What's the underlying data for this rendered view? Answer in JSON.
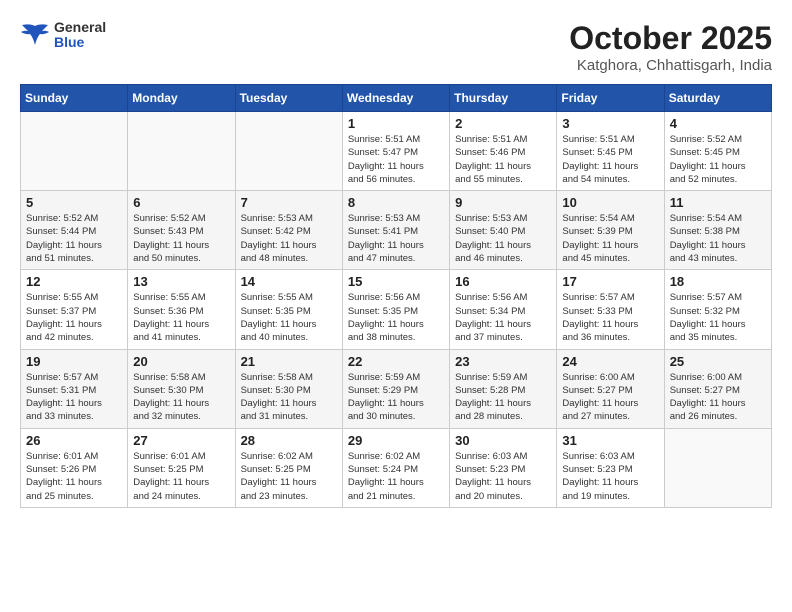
{
  "header": {
    "logo_general": "General",
    "logo_blue": "Blue",
    "month": "October 2025",
    "location": "Katghora, Chhattisgarh, India"
  },
  "weekdays": [
    "Sunday",
    "Monday",
    "Tuesday",
    "Wednesday",
    "Thursday",
    "Friday",
    "Saturday"
  ],
  "weeks": [
    [
      {
        "day": "",
        "info": ""
      },
      {
        "day": "",
        "info": ""
      },
      {
        "day": "",
        "info": ""
      },
      {
        "day": "1",
        "info": "Sunrise: 5:51 AM\nSunset: 5:47 PM\nDaylight: 11 hours\nand 56 minutes."
      },
      {
        "day": "2",
        "info": "Sunrise: 5:51 AM\nSunset: 5:46 PM\nDaylight: 11 hours\nand 55 minutes."
      },
      {
        "day": "3",
        "info": "Sunrise: 5:51 AM\nSunset: 5:45 PM\nDaylight: 11 hours\nand 54 minutes."
      },
      {
        "day": "4",
        "info": "Sunrise: 5:52 AM\nSunset: 5:45 PM\nDaylight: 11 hours\nand 52 minutes."
      }
    ],
    [
      {
        "day": "5",
        "info": "Sunrise: 5:52 AM\nSunset: 5:44 PM\nDaylight: 11 hours\nand 51 minutes."
      },
      {
        "day": "6",
        "info": "Sunrise: 5:52 AM\nSunset: 5:43 PM\nDaylight: 11 hours\nand 50 minutes."
      },
      {
        "day": "7",
        "info": "Sunrise: 5:53 AM\nSunset: 5:42 PM\nDaylight: 11 hours\nand 48 minutes."
      },
      {
        "day": "8",
        "info": "Sunrise: 5:53 AM\nSunset: 5:41 PM\nDaylight: 11 hours\nand 47 minutes."
      },
      {
        "day": "9",
        "info": "Sunrise: 5:53 AM\nSunset: 5:40 PM\nDaylight: 11 hours\nand 46 minutes."
      },
      {
        "day": "10",
        "info": "Sunrise: 5:54 AM\nSunset: 5:39 PM\nDaylight: 11 hours\nand 45 minutes."
      },
      {
        "day": "11",
        "info": "Sunrise: 5:54 AM\nSunset: 5:38 PM\nDaylight: 11 hours\nand 43 minutes."
      }
    ],
    [
      {
        "day": "12",
        "info": "Sunrise: 5:55 AM\nSunset: 5:37 PM\nDaylight: 11 hours\nand 42 minutes."
      },
      {
        "day": "13",
        "info": "Sunrise: 5:55 AM\nSunset: 5:36 PM\nDaylight: 11 hours\nand 41 minutes."
      },
      {
        "day": "14",
        "info": "Sunrise: 5:55 AM\nSunset: 5:35 PM\nDaylight: 11 hours\nand 40 minutes."
      },
      {
        "day": "15",
        "info": "Sunrise: 5:56 AM\nSunset: 5:35 PM\nDaylight: 11 hours\nand 38 minutes."
      },
      {
        "day": "16",
        "info": "Sunrise: 5:56 AM\nSunset: 5:34 PM\nDaylight: 11 hours\nand 37 minutes."
      },
      {
        "day": "17",
        "info": "Sunrise: 5:57 AM\nSunset: 5:33 PM\nDaylight: 11 hours\nand 36 minutes."
      },
      {
        "day": "18",
        "info": "Sunrise: 5:57 AM\nSunset: 5:32 PM\nDaylight: 11 hours\nand 35 minutes."
      }
    ],
    [
      {
        "day": "19",
        "info": "Sunrise: 5:57 AM\nSunset: 5:31 PM\nDaylight: 11 hours\nand 33 minutes."
      },
      {
        "day": "20",
        "info": "Sunrise: 5:58 AM\nSunset: 5:30 PM\nDaylight: 11 hours\nand 32 minutes."
      },
      {
        "day": "21",
        "info": "Sunrise: 5:58 AM\nSunset: 5:30 PM\nDaylight: 11 hours\nand 31 minutes."
      },
      {
        "day": "22",
        "info": "Sunrise: 5:59 AM\nSunset: 5:29 PM\nDaylight: 11 hours\nand 30 minutes."
      },
      {
        "day": "23",
        "info": "Sunrise: 5:59 AM\nSunset: 5:28 PM\nDaylight: 11 hours\nand 28 minutes."
      },
      {
        "day": "24",
        "info": "Sunrise: 6:00 AM\nSunset: 5:27 PM\nDaylight: 11 hours\nand 27 minutes."
      },
      {
        "day": "25",
        "info": "Sunrise: 6:00 AM\nSunset: 5:27 PM\nDaylight: 11 hours\nand 26 minutes."
      }
    ],
    [
      {
        "day": "26",
        "info": "Sunrise: 6:01 AM\nSunset: 5:26 PM\nDaylight: 11 hours\nand 25 minutes."
      },
      {
        "day": "27",
        "info": "Sunrise: 6:01 AM\nSunset: 5:25 PM\nDaylight: 11 hours\nand 24 minutes."
      },
      {
        "day": "28",
        "info": "Sunrise: 6:02 AM\nSunset: 5:25 PM\nDaylight: 11 hours\nand 23 minutes."
      },
      {
        "day": "29",
        "info": "Sunrise: 6:02 AM\nSunset: 5:24 PM\nDaylight: 11 hours\nand 21 minutes."
      },
      {
        "day": "30",
        "info": "Sunrise: 6:03 AM\nSunset: 5:23 PM\nDaylight: 11 hours\nand 20 minutes."
      },
      {
        "day": "31",
        "info": "Sunrise: 6:03 AM\nSunset: 5:23 PM\nDaylight: 11 hours\nand 19 minutes."
      },
      {
        "day": "",
        "info": ""
      }
    ]
  ]
}
